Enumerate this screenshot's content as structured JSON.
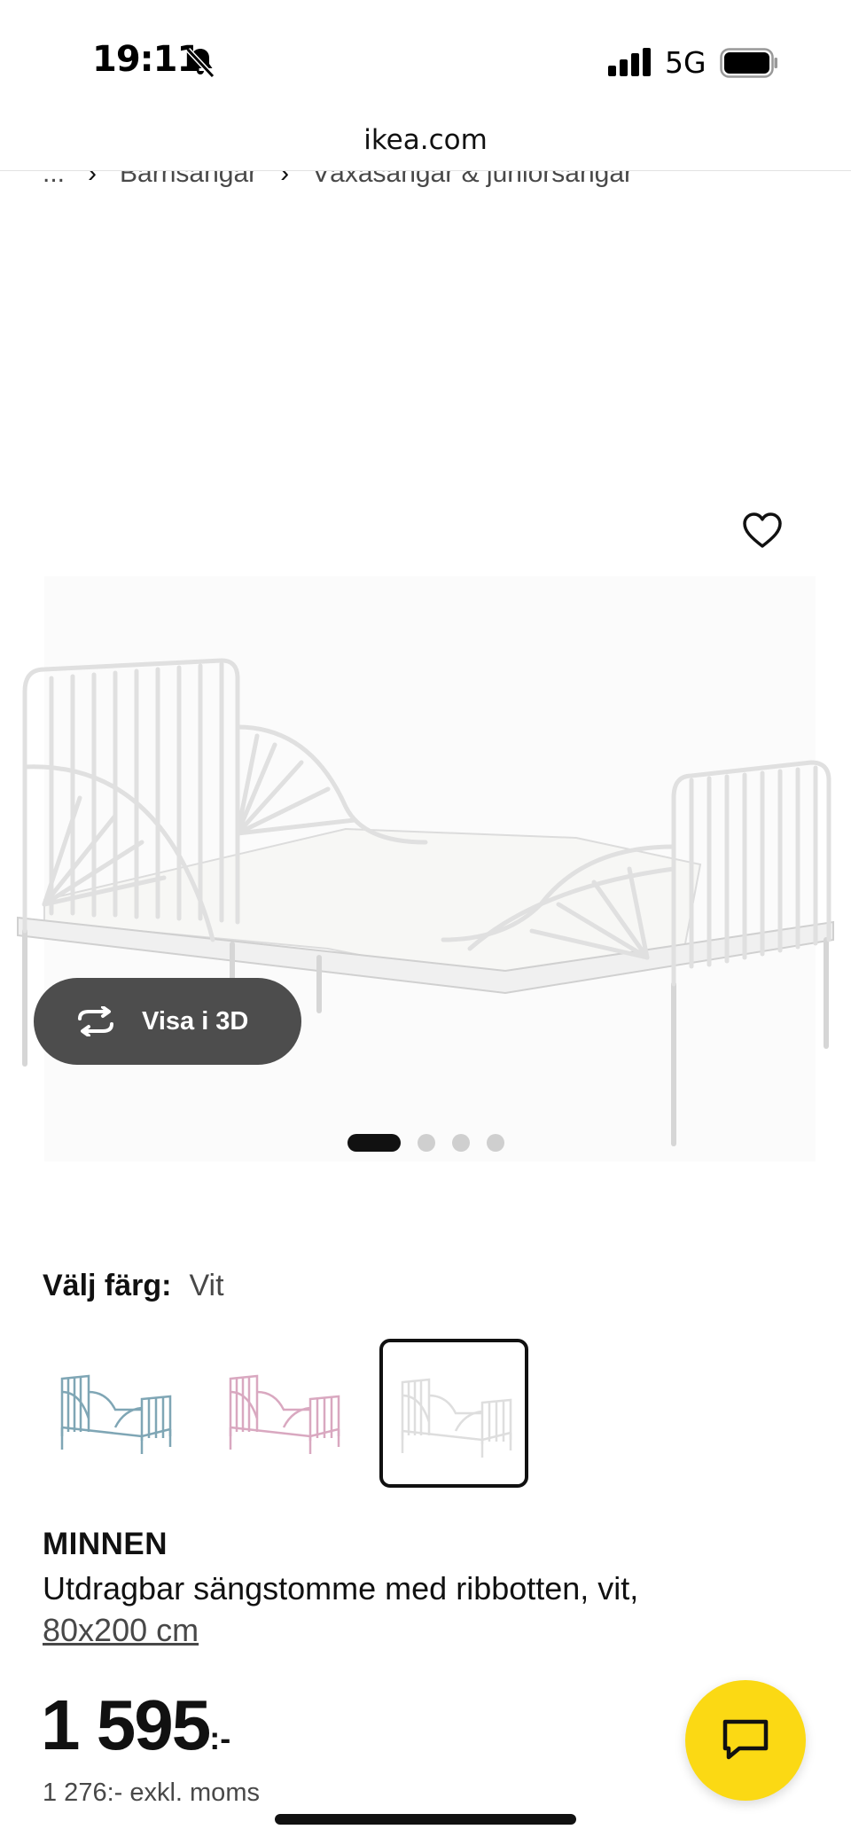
{
  "status_bar": {
    "time": "19:11",
    "network": "5G",
    "icons": [
      "bell-slash-icon",
      "signal-icon",
      "battery-icon"
    ]
  },
  "browser": {
    "url": "ikea.com"
  },
  "breadcrumb": {
    "items": [
      "...",
      "Barnsängar",
      "Växasängar & juniorsängar"
    ]
  },
  "gallery": {
    "view_3d_label": "Visa i 3D",
    "view_3d_icon": "rotate-icon",
    "favorite_icon": "heart-icon",
    "slide_count": 4,
    "active_slide": 1
  },
  "color_picker": {
    "label": "Välj färg:",
    "selected_value": "Vit",
    "swatches": [
      {
        "name": "blue",
        "color": "#7fa6b5"
      },
      {
        "name": "pink",
        "color": "#d9a8c0"
      },
      {
        "name": "white",
        "color": "#e8e8e8",
        "selected": true
      }
    ]
  },
  "product": {
    "name": "MINNEN",
    "description": "Utdragbar sängstomme med ribbotten, vit,",
    "size": "80x200 cm",
    "price_main": "1 595",
    "price_suffix": ":-",
    "price_excl_vat": "1 276:- exkl. moms"
  },
  "chat": {
    "icon": "chat-icon",
    "color": "#fbd914"
  }
}
